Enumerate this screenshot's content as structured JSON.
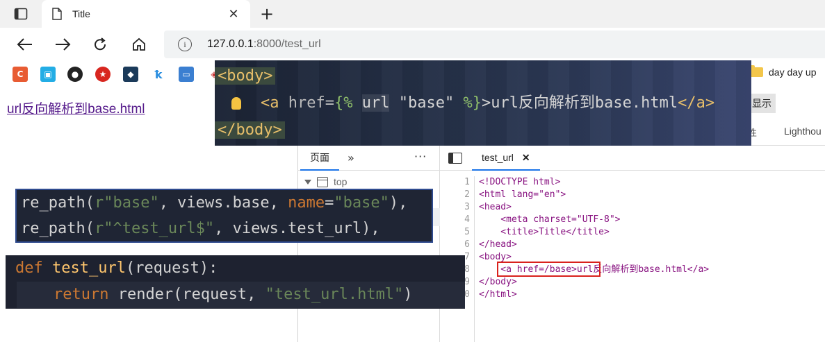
{
  "browser": {
    "tab_title": "Title",
    "tab_close": "✕",
    "new_tab": "+",
    "address_host": "127.0.0.1",
    "address_path": ":8000/test_url",
    "info_icon": "i",
    "bookmark_folder": "day day up"
  },
  "page": {
    "link_text": "url反向解析到base.html"
  },
  "devtools": {
    "show_button": "显示",
    "partial_tab": "性",
    "lighthouse_tab": "Lighthou",
    "sources_tab": "页面",
    "more_tabs": "»",
    "menu_dots": "⋮",
    "tree_top": "top",
    "file_tab": "test_url",
    "file_close": "✕",
    "line_numbers": [
      "1",
      "2",
      "3",
      "4",
      "5",
      "6",
      "7",
      "8",
      "9",
      "10"
    ],
    "code_lines": [
      "<!DOCTYPE html>",
      "<html lang=\"en\">",
      "<head>",
      "    <meta charset=\"UTF-8\">",
      "    <title>Title</title>",
      "</head>",
      "<body>",
      "    <a href=/base>url反向解析到base.html</a>",
      "</body>",
      "</html>"
    ]
  },
  "ide_template": {
    "line1": "<body>",
    "line2_tag_open": "<a ",
    "line2_attr": "href=",
    "line2_tpl_open": "{% ",
    "line2_url": "url",
    "line2_str": " \"base\" ",
    "line2_tpl_close": "%}",
    "line2_text": ">url反向解析到base.html",
    "line2_tag_close": "</a>",
    "line3": "</body>"
  },
  "ide_urls": {
    "line1_fn": "re_path(",
    "line1_str": "r\"base\"",
    "line1_mid": ", views.base, ",
    "line1_kw": "name",
    "line1_eq": "=",
    "line1_name": "\"base\"",
    "line1_end": "),",
    "line2_fn": "re_path(",
    "line2_str": "r\"^test_url$\"",
    "line2_end": ", views.test_url),"
  },
  "ide_views": {
    "line1_def": "def ",
    "line1_fn": "test_url",
    "line1_rest": "(request):",
    "line2_ret": "return ",
    "line2_call": "render(request, ",
    "line2_str": "\"test_url.html\"",
    "line2_end": ")"
  },
  "colors": {
    "link_visited": "#551a8b",
    "highlight_box": "#d9211c",
    "devtools_active": "#1a73e8"
  }
}
